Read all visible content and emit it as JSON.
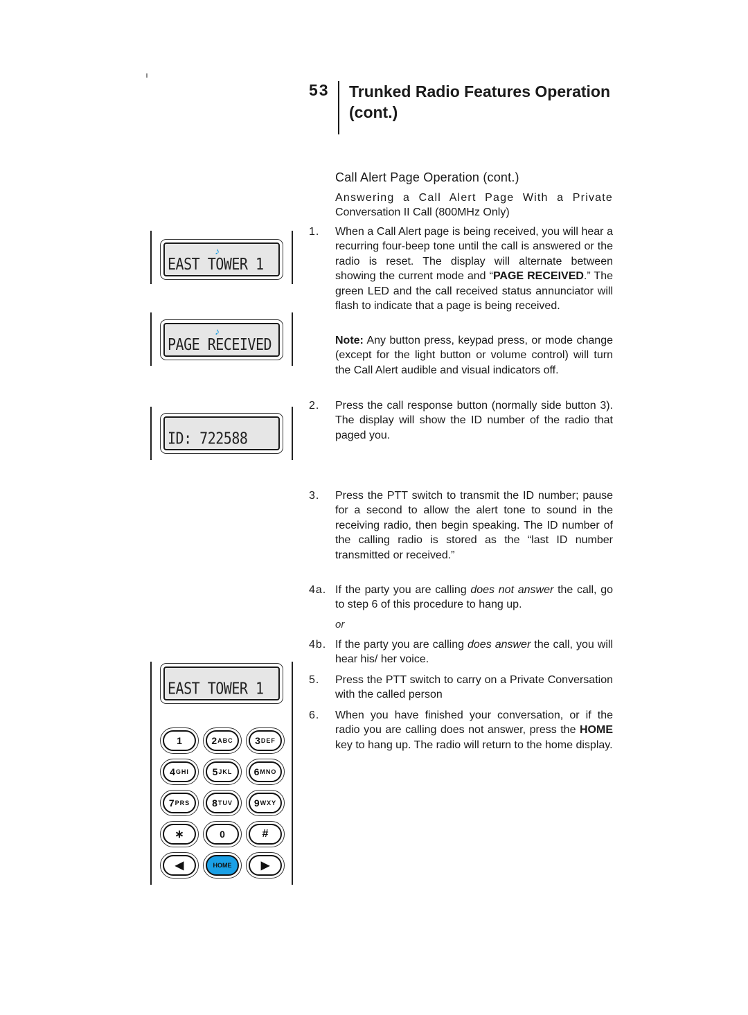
{
  "header": {
    "chapter_number": "53",
    "chapter_title_line1": "Trunked Radio Features Operation",
    "chapter_title_line2": "(cont.)"
  },
  "section": {
    "title": "Call Alert Page Operation (cont.)",
    "subtitle_line1": "Answering a Call Alert Page With a Private",
    "subtitle_line2": "Conversation II Call (800MHz Only)"
  },
  "steps": [
    {
      "num": "1.",
      "parts": [
        {
          "t": "When a Call Alert page is being received, you will hear a recurring four-beep tone until the call is answered or the radio is reset. The display will alternate between showing the current mode and “"
        },
        {
          "b": "PAGE RECEIVED"
        },
        {
          "t": ".” The green LED and the call received status annunciator will flash to indicate that a page is being received."
        }
      ]
    },
    {
      "num": "",
      "parts": [
        {
          "b": "Note:"
        },
        {
          "t": " Any button press, keypad press, or mode change (except for the light button or volume control) will turn the Call Alert audible and visual indicators off."
        }
      ]
    },
    {
      "num": "2.",
      "parts": [
        {
          "t": "Press the call response button (normally side button 3). The display will show the ID number of the radio that paged you."
        }
      ]
    },
    {
      "num": "3.",
      "parts": [
        {
          "t": "Press the PTT switch to transmit the ID number; pause for a second to allow the alert tone to sound in the receiving radio, then begin speaking. The ID number of the calling radio is stored as the “last ID number transmitted or received.”"
        }
      ]
    },
    {
      "num": "4a.",
      "parts": [
        {
          "t": "If the party you are calling "
        },
        {
          "i": "does not answer"
        },
        {
          "t": " the call, go to step 6 of this procedure to hang up."
        }
      ]
    },
    {
      "num": "4b.",
      "parts": [
        {
          "t": "If the party you are calling "
        },
        {
          "i": "does answer"
        },
        {
          "t": " the call, you will hear his/ her voice."
        }
      ]
    },
    {
      "num": "5.",
      "parts": [
        {
          "t": "Press the PTT switch to carry on a Private Conversation with the called person"
        }
      ]
    },
    {
      "num": "6.",
      "parts": [
        {
          "t": "When you have finished your conversation, or if the radio you are calling does not answer, press the "
        },
        {
          "b": "HOME"
        },
        {
          "t": " key to hang up. The radio will return to the home display."
        }
      ]
    }
  ],
  "or_text": "or",
  "displays": [
    {
      "note_icon": "♪",
      "text": "EAST TOWER 1"
    },
    {
      "note_icon": "♪",
      "text": "PAGE RECEIVED"
    },
    {
      "note_icon": "",
      "text": "ID: 722588"
    },
    {
      "note_icon": "",
      "text": "EAST TOWER 1"
    }
  ],
  "keypad": {
    "keys": [
      {
        "main": "1",
        "sub": ""
      },
      {
        "main": "2",
        "sub": "ABC"
      },
      {
        "main": "3",
        "sub": "DEF"
      },
      {
        "main": "4",
        "sub": "GHI"
      },
      {
        "main": "5",
        "sub": "JKL"
      },
      {
        "main": "6",
        "sub": "MNO"
      },
      {
        "main": "7",
        "sub": "PRS"
      },
      {
        "main": "8",
        "sub": "TUV"
      },
      {
        "main": "9",
        "sub": "WXY"
      },
      {
        "main": "∗",
        "sub": ""
      },
      {
        "main": "0",
        "sub": ""
      },
      {
        "main": "#",
        "sub": ""
      },
      {
        "main": "◀",
        "sub": ""
      },
      {
        "main": "HOME",
        "sub": ""
      },
      {
        "main": "▶",
        "sub": ""
      }
    ],
    "home_color": "#1aa0e6"
  },
  "colors": {
    "note_icon": "#1a9be0",
    "lcd_background": "#e6e6e6"
  }
}
